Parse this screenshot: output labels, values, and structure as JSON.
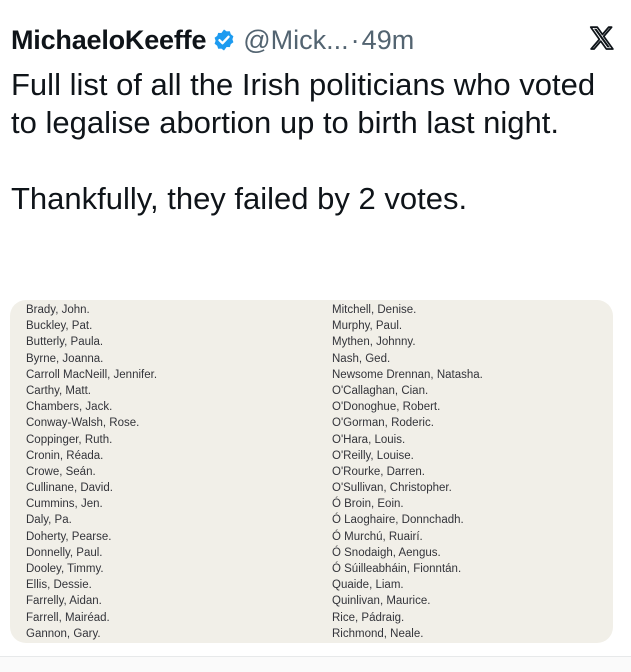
{
  "tweet": {
    "author": "MichaeloKeeffe",
    "handle": "@Mick...",
    "separator": "·",
    "time": "49m",
    "text_line1": "Full list of all the Irish politicians who voted to legalise abortion up to birth last night.",
    "text_line2": "Thankfully, they failed by 2 votes."
  },
  "icons": {
    "verified": "verified-badge-icon",
    "platform": "x-logo-icon"
  },
  "colors": {
    "verified": "#1d9bf0",
    "muted": "#536471",
    "doc_bg": "#f1efe8"
  },
  "document": {
    "left_column": [
      "Brady, John.",
      "Buckley, Pat.",
      "Butterly, Paula.",
      "Byrne, Joanna.",
      "Carroll MacNeill, Jennifer.",
      "Carthy, Matt.",
      "Chambers, Jack.",
      "Conway-Walsh, Rose.",
      "Coppinger, Ruth.",
      "Cronin, Réada.",
      "Crowe, Seán.",
      "Cullinane, David.",
      "Cummins, Jen.",
      "Daly, Pa.",
      "Doherty, Pearse.",
      "Donnelly, Paul.",
      "Dooley, Timmy.",
      "Ellis, Dessie.",
      "Farrelly, Aidan.",
      "Farrell, Mairéad.",
      "Gannon, Gary."
    ],
    "right_column": [
      "Mitchell, Denise.",
      "Murphy, Paul.",
      "Mythen, Johnny.",
      "Nash, Ged.",
      "Newsome Drennan, Natasha.",
      "O'Callaghan, Cian.",
      "O'Donoghue, Robert.",
      "O'Gorman, Roderic.",
      "O'Hara, Louis.",
      "O'Reilly, Louise.",
      "O'Rourke, Darren.",
      "O'Sullivan, Christopher.",
      "Ó Broin, Eoin.",
      "Ó Laoghaire, Donnchadh.",
      "Ó Murchú, Ruairí.",
      "Ó Snodaigh, Aengus.",
      "Ó Súilleabháin, Fionntán.",
      "Quaide, Liam.",
      "Quinlivan, Maurice.",
      "Rice, Pádraig.",
      "Richmond, Neale."
    ]
  }
}
